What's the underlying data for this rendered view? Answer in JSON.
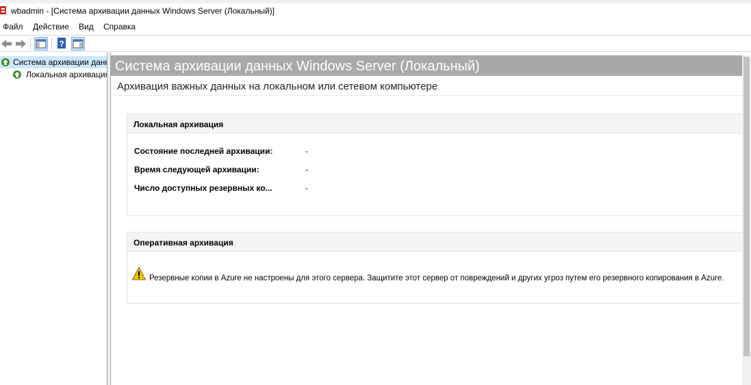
{
  "window": {
    "title": "wbadmin - [Система архивации данных Windows Server (Локальный)]"
  },
  "menu": {
    "items": [
      "Файл",
      "Действие",
      "Вид",
      "Справка"
    ]
  },
  "toolbar": {
    "icons": [
      "back-arrow-icon",
      "forward-arrow-icon",
      "show-hide-console-tree-icon",
      "help-icon",
      "action-pane-icon"
    ]
  },
  "tree": {
    "root_label": "Система архивации данных Windows Server (Локальный)",
    "child_label": "Локальная архивация"
  },
  "main": {
    "header_title": "Система архивации данных Windows Server (Локальный)",
    "subtitle": "Архивация важных данных на локальном или сетевом компьютере",
    "local_backup": {
      "title": "Локальная архивация",
      "rows": [
        {
          "label": "Состояние последней архивации:",
          "value": "-"
        },
        {
          "label": "Время следующей архивации:",
          "value": "-"
        },
        {
          "label": "Число доступных резервных ко...",
          "value": "-"
        }
      ]
    },
    "online_backup": {
      "title": "Оперативная архивация",
      "message": "Резервные копии в Azure не настроены для этого сервера. Защитите этот сервер от повреждений и других угроз путем его резервного копирования в Azure."
    }
  },
  "colors": {
    "header_band": "#a9a9a9",
    "selection": "#cce8ff",
    "warning": "#f2c400"
  }
}
